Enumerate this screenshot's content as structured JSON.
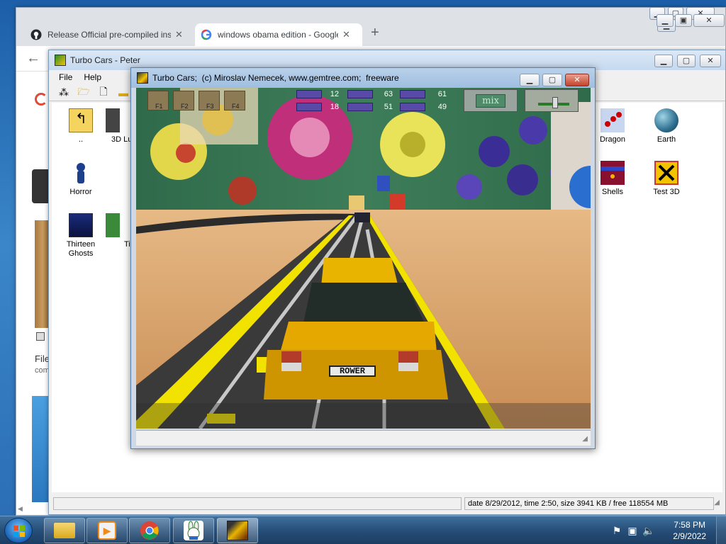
{
  "browser": {
    "tabs": [
      {
        "label": "Release Official pre-compiled ins",
        "icon": "github-icon"
      },
      {
        "label": "windows obama edition - Google",
        "icon": "google-icon"
      }
    ],
    "new_tab": "+",
    "left_texts": [
      "File",
      "com"
    ]
  },
  "explorer": {
    "title": "Turbo Cars - Peter",
    "menu": {
      "file": "File",
      "help": "Help"
    },
    "items": [
      {
        "label": "..",
        "icon": "up-folder-icon"
      },
      {
        "label": "3D Lu",
        "icon": "program-icon"
      },
      {
        "label": "Dragon",
        "icon": "dragon-icon"
      },
      {
        "label": "Earth",
        "icon": "earth-icon"
      },
      {
        "label": "Horror",
        "icon": "horror-icon"
      },
      {
        "label": "Shells",
        "icon": "shells-icon"
      },
      {
        "label": "Test 3D",
        "icon": "test3d-icon"
      },
      {
        "label": "Thirteen Ghosts",
        "icon": "thirteen-ghosts-icon"
      },
      {
        "label": "Tit",
        "icon": "program-icon"
      }
    ],
    "status": "date 8/29/2012, time 2:50, size 3941 KB / free 118554 MB"
  },
  "game": {
    "title": "Turbo Cars;  (c) Miroslav Nemecek, www.gemtree.com;  freeware",
    "hud": {
      "keys": [
        "F1",
        "F2",
        "F3",
        "F4"
      ],
      "scores": [
        "12",
        "18",
        "63",
        "51",
        "61",
        "49"
      ],
      "mix_label": "mix"
    },
    "license_plate": "ROWER"
  },
  "taskbar": {
    "time": "7:58 PM",
    "date": "2/9/2022"
  }
}
